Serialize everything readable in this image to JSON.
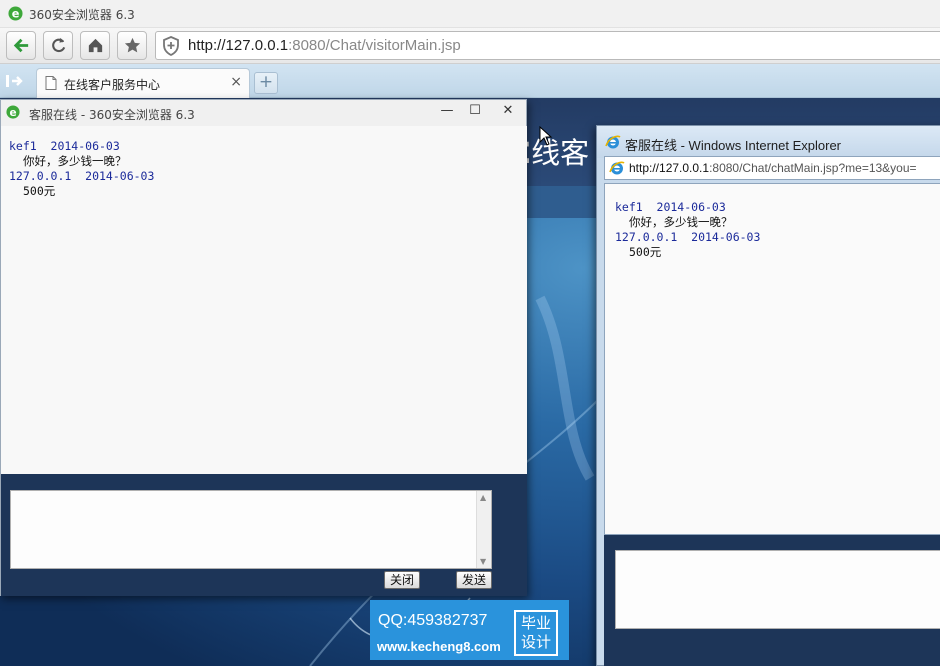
{
  "main_window": {
    "title": "360安全浏览器 6.3",
    "address_url_host": "http://127.0.0.1",
    "address_url_rest": ":8080/Chat/visitorMain.jsp",
    "tab_label": "在线客户服务中心",
    "close_glyph": "×",
    "new_tab_glyph": "+"
  },
  "page": {
    "heading_fragment": "E线客"
  },
  "popup_360": {
    "title": "客服在线 - 360安全浏览器 6.3",
    "minimize_glyph": "—",
    "maximize_glyph": "☐",
    "close_glyph": "✕",
    "messages": [
      {
        "meta": "kef1  2014-06-03",
        "text": "你好，多少钱一晚？"
      },
      {
        "meta": "127.0.0.1  2014-06-03",
        "text": "500元"
      }
    ],
    "close_button": "关闭",
    "send_button": "发送"
  },
  "popup_ie": {
    "title": "客服在线 - Windows Internet Explorer",
    "address_url_host": "http://127.0.0.1",
    "address_url_rest": ":8080/Chat/chatMain.jsp?me=13&you=",
    "messages": [
      {
        "meta": "kef1  2014-06-03",
        "text": "你好，多少钱一晚？"
      },
      {
        "meta": "127.0.0.1  2014-06-03",
        "text": "500元"
      }
    ]
  },
  "watermark": {
    "qq": "QQ:459382737",
    "site": "www.kecheng8.com",
    "badge_line1": "毕业",
    "badge_line2": "设计"
  },
  "colors": {
    "chat_meta": "#1b2a9a",
    "page_blue": "#2a6aa5",
    "watermark_blue": "#2a93dc",
    "app_green": "#3ea83a"
  }
}
